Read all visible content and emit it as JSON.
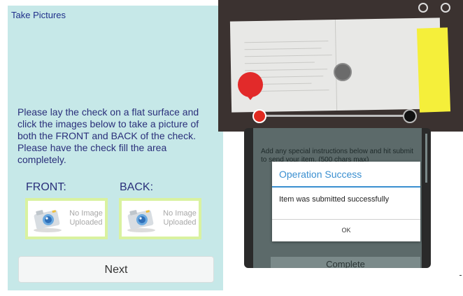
{
  "left_panel": {
    "title": "Take Pictures",
    "instructions": "Please lay the check on a flat surface and click the images below to take a picture of both the FRONT and BACK of the check. Please have the check fill the area completely.",
    "front_label": "FRONT:",
    "back_label": "BACK:",
    "no_image_text": "No Image Uploaded",
    "next_button": "Next",
    "colors": {
      "background": "#c6e8e8",
      "text": "#2a2f7a",
      "upload_border": "#d9f2a0"
    }
  },
  "phone": {
    "background_text": "Add any special instructions below and hit submit to send your item. (500 chars max)",
    "complete_button": "Complete",
    "dialog": {
      "title": "Operation Success",
      "message": "Item was submitted successfully",
      "ok_button": "OK"
    },
    "colors": {
      "accent": "#3a8fd0"
    }
  },
  "camera": {
    "red_pin_icon": "map-pin-icon",
    "slider_level": 0
  }
}
